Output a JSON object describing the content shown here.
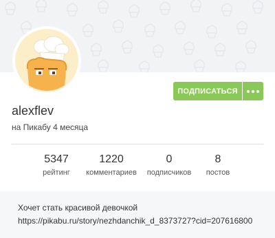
{
  "profile": {
    "username": "alexflev",
    "since": "на Пикабу 4 месяца",
    "subscribe_label": "ПОДПИСАТЬСЯ",
    "more_label": "•••",
    "bio_line1": "Хочет стать красивой девочкой",
    "bio_line2": "https://pikabu.ru/story/nezhdanchik_d_8373727?cid=207616800"
  },
  "stats": [
    {
      "value": "5347",
      "label": "рейтинг"
    },
    {
      "value": "1220",
      "label": "комментариев"
    },
    {
      "value": "0",
      "label": "подписчиков"
    },
    {
      "value": "8",
      "label": "постов"
    }
  ],
  "colors": {
    "accent": "#8ac858",
    "banner_bg": "#f2f3f5",
    "about_bg": "#f6f7f9"
  },
  "icons": {
    "banner_pattern": "cupcake-pattern-icon",
    "avatar": "bread-chef-avatar-icon",
    "more": "more-dots-icon"
  }
}
